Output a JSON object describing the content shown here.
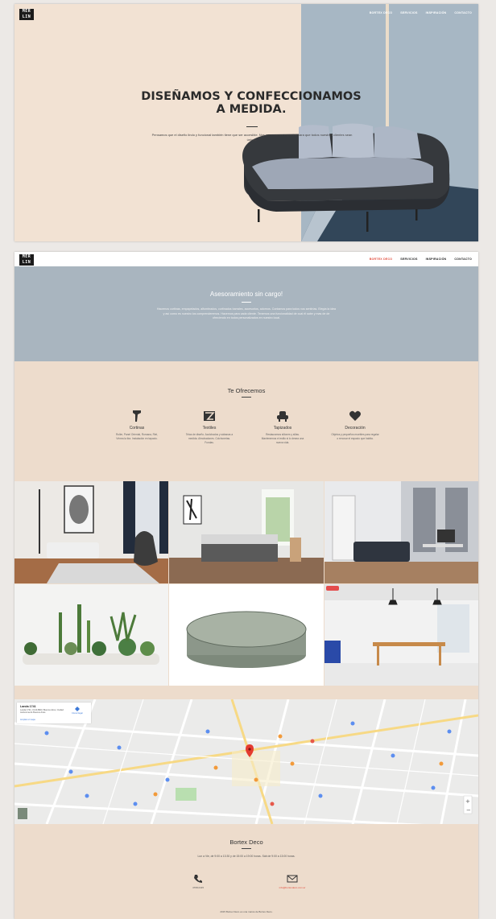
{
  "hero": {
    "logo": "MER LIN",
    "nav": [
      "BORTEX DECO",
      "SERVICIOS",
      "INSPIRACIÓN",
      "CONTACTO"
    ],
    "title": "DISEÑAMOS Y CONFECCIONAMOS A MEDIDA.",
    "subtitle": "Pensamos que el diseño lindo y funcional también tiene que ser accesible. Nos asesoramos espacios para que todos nuestros clientes sean únicos."
  },
  "page": {
    "logo": "MER LIN",
    "nav": [
      "BORTEX DECO",
      "SERVICIOS",
      "INSPIRACIÓN",
      "CONTACTO"
    ],
    "advice_title": "Asesoramiento sin cargo!",
    "advice_text": "Hacemos cortinas, empapelados, alfombrados, cortinados barrales, accesorios, adornos. Contamos para todos vos sentirías. Elegía la idea y así como es nuestro los comprenderemos. Hacemos para cada cliente. Tenemos una funcionalidad de cual él sabe y mas de de ofreciendo en todos personalizados en nuestro local.",
    "offer_title": "Te Ofrecemos",
    "services": [
      {
        "icon": "curtain-icon",
        "title": "Cortinas",
        "desc": "Roller, Panel Oriental, Romana, Riel, Vénea la tira. Instalación en tapacio."
      },
      {
        "icon": "textile-icon",
        "title": "Textiles",
        "desc": "Telas de diseño. Acolchados y sábanas a medida. Almohadones. Colchonetas. Fundas."
      },
      {
        "icon": "armchair-icon",
        "title": "Tapizados",
        "desc": "Restauramos sillones y sillas. Mantenemos el estilo si lo desea una nueva vida."
      },
      {
        "icon": "heart-icon",
        "title": "Decoración",
        "desc": "Objetos y pequeños muebles para regalar o renovar el espacio que habita."
      }
    ],
    "map": {
      "place_name": "Landa 1741",
      "address": "Landa 1741, C1414BAC Buenos Aires, Ciudad Autónoma de Buenos Aires",
      "directions_label": "Cómo llegar",
      "larger_map_label": "Ampliar el mapa"
    },
    "footer": {
      "brand": "Bortex Deco",
      "hours": "Lun a Vie, de 9:00 a 13:30 y de 15:00 a 19:00 horas. Sáb de 9:00 a 13:00 horas.",
      "phone": "4768-0115",
      "email": "info@bortexdeco.com.ar",
      "copyright": "2015 Bortex Deco es una marca de Bortex Deco."
    }
  },
  "colors": {
    "beige": "#eddccc",
    "blue_grey": "#a9b5bf",
    "accent_red": "#e24c3c"
  }
}
